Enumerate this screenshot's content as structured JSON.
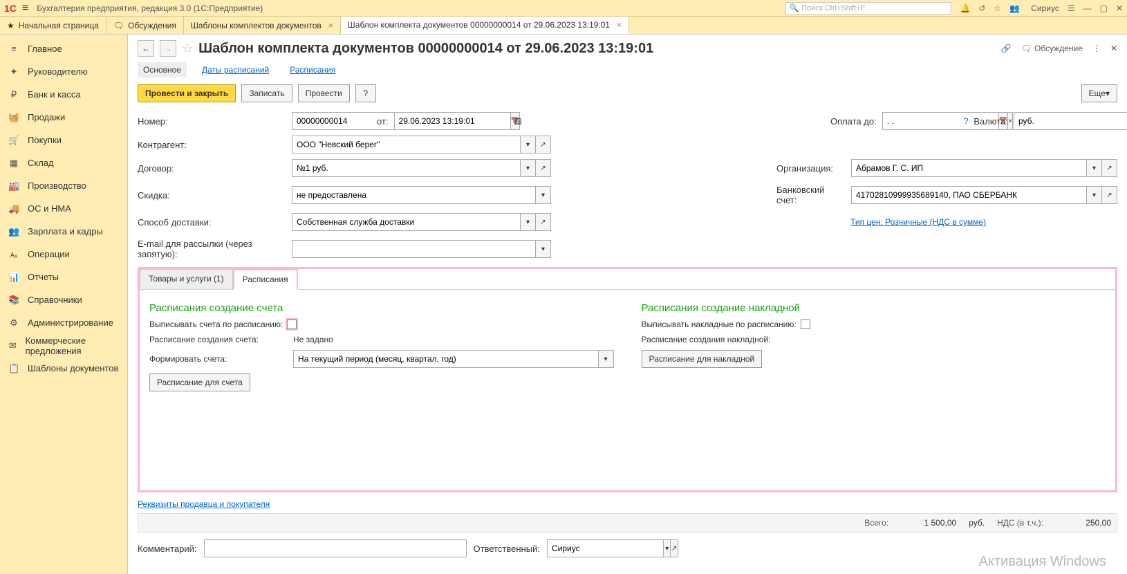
{
  "titlebar": {
    "app_title": "Бухгалтерия предприятия, редакция 3.0  (1С:Предприятие)",
    "search_placeholder": "Поиск Ctrl+Shift+F",
    "user": "Сириус"
  },
  "tabs": [
    {
      "label": "Начальная страница",
      "icon": "★"
    },
    {
      "label": "Обсуждения",
      "icon": "🗨"
    },
    {
      "label": "Шаблоны комплектов документов",
      "closable": true
    },
    {
      "label": "Шаблон комплекта документов 00000000014 от 29.06.2023 13:19:01",
      "closable": true,
      "active": true
    }
  ],
  "sidebar": [
    {
      "icon": "≡",
      "label": "Главное"
    },
    {
      "icon": "✦",
      "label": "Руководителю"
    },
    {
      "icon": "₽",
      "label": "Банк и касса"
    },
    {
      "icon": "🧺",
      "label": "Продажи"
    },
    {
      "icon": "🛒",
      "label": "Покупки"
    },
    {
      "icon": "▦",
      "label": "Склад"
    },
    {
      "icon": "🏭",
      "label": "Производство"
    },
    {
      "icon": "🚚",
      "label": "ОС и НМА"
    },
    {
      "icon": "👥",
      "label": "Зарплата и кадры"
    },
    {
      "icon": "ᴀₓ",
      "label": "Операции"
    },
    {
      "icon": "📊",
      "label": "Отчеты"
    },
    {
      "icon": "📚",
      "label": "Справочники"
    },
    {
      "icon": "⚙",
      "label": "Администрирование"
    },
    {
      "icon": "✉",
      "label": "Коммерческие предложения"
    },
    {
      "icon": "📋",
      "label": "Шаблоны документов"
    }
  ],
  "doc": {
    "title": "Шаблон комплекта документов 00000000014 от 29.06.2023 13:19:01",
    "discuss": "Обсуждение"
  },
  "subtabs": {
    "main": "Основное",
    "dates": "Даты расписаний",
    "schedules": "Расписания"
  },
  "actions": {
    "post_close": "Провести и закрыть",
    "save": "Записать",
    "post": "Провести",
    "help": "?",
    "more": "Еще"
  },
  "form": {
    "number_label": "Номер:",
    "number": "00000000014",
    "from_label": "от:",
    "date": "29.06.2023 13:19:01",
    "pay_until_label": "Оплата до:",
    "pay_until": ". .",
    "currency_label": "Валюта:",
    "currency": "руб.",
    "counterparty_label": "Контрагент:",
    "counterparty": "ООО \"Невский берег\"",
    "contract_label": "Договор:",
    "contract": "№1 руб.",
    "org_label": "Организация:",
    "org": "Абрамов Г. С. ИП",
    "discount_label": "Скидка:",
    "discount": "не предоставлена",
    "bank_label": "Банковский счет:",
    "bank": "41702810999935689140, ПАО СБЕРБАНК",
    "delivery_label": "Способ доставки:",
    "delivery": "Собственная служба доставки",
    "price_type_link": "Тип цен: Розничные (НДС в сумме)",
    "email_label": "E-mail для рассылки (через запятую):",
    "email": ""
  },
  "inner_tabs": {
    "goods": "Товары и услуги (1)",
    "schedules": "Расписания"
  },
  "sched": {
    "invoice_title": "Расписания создание счета",
    "invoice_chk": "Выписывать счета по расписанию:",
    "invoice_sched_label": "Расписание создания счета:",
    "invoice_sched_val": "Не задано",
    "form_inv_label": "Формировать счета:",
    "form_inv_val": "На текущий период (месяц, квартал, год)",
    "invoice_btn": "Расписание для счета",
    "nakl_title": "Расписания создание накладной",
    "nakl_chk": "Выписывать накладные по расписанию:",
    "nakl_sched_label": "Расписание создания накладной:",
    "nakl_btn": "Расписание для накладной"
  },
  "bottom": {
    "req_link": "Реквизиты продавца и покупателя",
    "total_label": "Всего:",
    "total": "1 500,00",
    "currency": "руб.",
    "nds_label": "НДС (в т.ч.):",
    "nds": "250,00",
    "comment_label": "Комментарий:",
    "comment": "",
    "resp_label": "Ответственный:",
    "resp": "Сириус"
  },
  "watermark": "Активация Windows"
}
